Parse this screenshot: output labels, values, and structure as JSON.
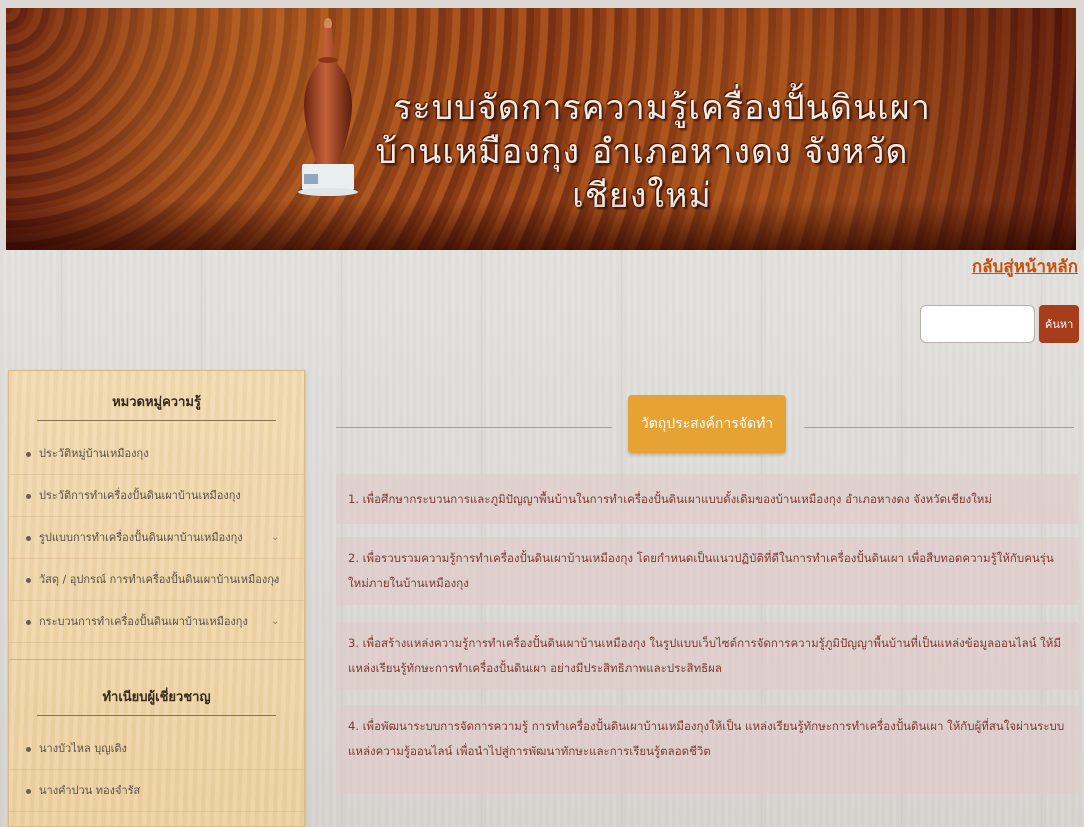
{
  "banner": {
    "title_line1": "ระบบจัดการความรู้เครื่องปั้นดินเผา",
    "title_line2": "บ้านเหมืองกุง อำเภอหางดง จังหวัดเชียงใหม่"
  },
  "nav": {
    "home_link": "กลับสู่หน้าหลัก"
  },
  "search": {
    "button_label": "ค้นหา",
    "value": ""
  },
  "sidebar": {
    "knowledge_heading": "หมวดหมู่ความรู้",
    "knowledge_items": [
      {
        "label": "ประวัติหมู่บ้านเหมืองกุง",
        "has_submenu": false
      },
      {
        "label": "ประวัติการทำเครื่องปั้นดินเผาบ้านเหมืองกุง",
        "has_submenu": false
      },
      {
        "label": "รูปแบบการทำเครื่องปั้นดินเผาบ้านเหมืองกุง",
        "has_submenu": true
      },
      {
        "label": "วัสดุ / อุปกรณ์ การทำเครื่องปั้นดินเผาบ้านเหมืองกุง",
        "has_submenu": true
      },
      {
        "label": "กระบวนการทำเครื่องปั้นดินเผาบ้านเหมืองกุง",
        "has_submenu": true
      }
    ],
    "experts_heading": "ทำเนียบผู้เชี่ยวชาญ",
    "expert_items": [
      {
        "label": "นางบัวไหล บุญเติง"
      },
      {
        "label": "นางคำปวน ทองจำรัส"
      }
    ]
  },
  "main": {
    "objective_heading": "วัตถุประสงค์การจัดทำ",
    "objectives": [
      "1. เพื่อศึกษากระบวนการและภูมิปัญญาพื้นบ้านในการทำเครื่องปั้นดินเผาแบบดั้งเดิมของบ้านเหมืองกุง อำเภอหางดง จังหวัดเชียงใหม่",
      "2. เพื่อรวบรวมความรู้การทำเครื่องปั้นดินเผาบ้านเหมืองกุง โดยกำหนดเป็นแนวปฏิบัติที่ดีในการทำเครื่องปั้นดินเผา เพื่อสืบทอดความรู้ให้กับคนรุ่นใหม่ภายในบ้านเหมืองกุง",
      "3. เพื่อสร้างแหล่งความรู้การทำเครื่องปั้นดินเผาบ้านเหมืองกุง ในรูปแบบเว็บไซต์การจัดการความรู้ภูมิปัญญาพื้นบ้านที่เป็นแหล่งข้อมูลออนไลน์ ให้มีแหล่งเรียนรู้ทักษะการทำเครื่องปั้นดินเผา อย่างมีประสิทธิภาพและประสิทธิผล",
      "4. เพื่อพัฒนาระบบการจัดการความรู้ การทำเครื่องปั้นดินเผาบ้านเหมืองกุงให้เป็น แหล่งเรียนรู้ทักษะการทำเครื่องปั้นดินเผา ให้กับผู้ที่สนใจผ่านระบบแหล่งความรู้ออนไลน์ เพื่อนำไปสู่การพัฒนาทักษะและการเรียนรู้ตลอดชีวิต"
    ]
  },
  "colors": {
    "accent_orange": "#e6a233",
    "link_orange": "#c8500a",
    "search_button": "#a83d1c",
    "objective_text": "#7a3b30"
  }
}
